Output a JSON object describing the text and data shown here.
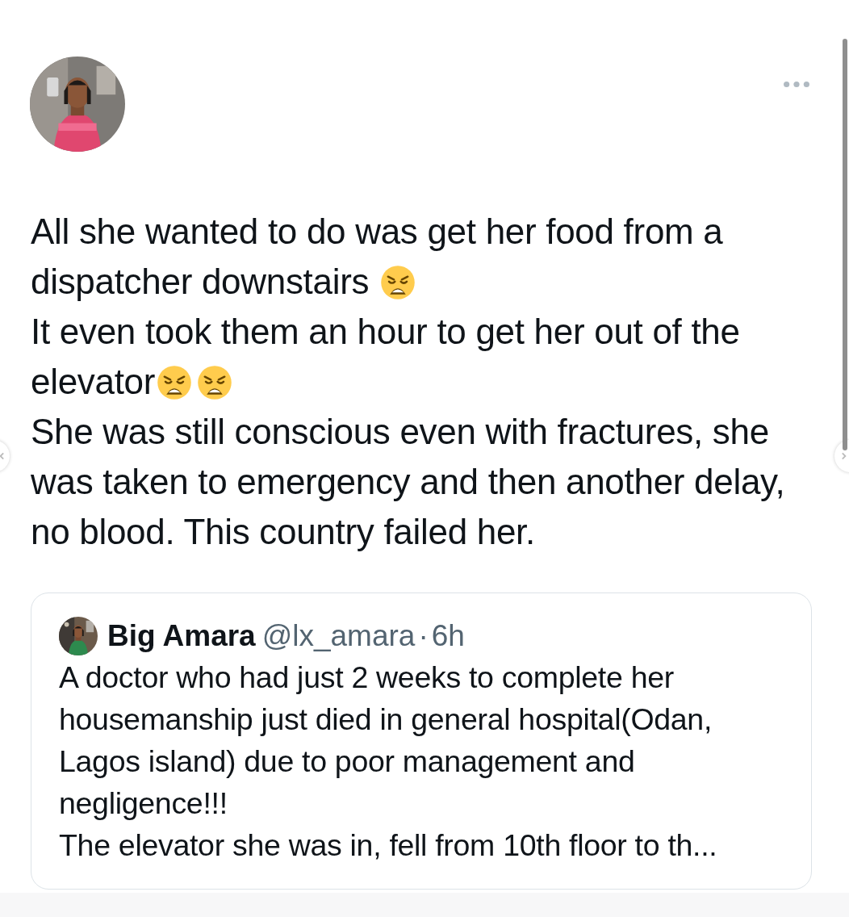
{
  "post": {
    "avatar": {
      "kind": "picture"
    },
    "body": [
      [
        {
          "kind": "text",
          "text": "All she wanted to do was get her food from a dispatcher downstairs "
        },
        {
          "kind": "emoji"
        }
      ],
      [
        {
          "kind": "text",
          "text": "It even took them an hour to get her out of the elevator"
        },
        {
          "kind": "emoji"
        },
        {
          "kind": "emoji"
        }
      ],
      [
        {
          "kind": "text",
          "text": "She was still conscious even with fractures, she was taken to emergency and then another delay, no blood. This country failed her."
        }
      ]
    ],
    "quote": {
      "avatar": {
        "kind": "picture"
      },
      "name": "Big Amara",
      "handle": "@lx_amara",
      "separator": "·",
      "time": "6h",
      "lines": [
        "A doctor who had just 2 weeks to complete her housemanship just died in general hospital(Odan, Lagos island) due to poor management and negligence!!!",
        "The elevator she was in, fell from 10th floor to th..."
      ]
    }
  }
}
